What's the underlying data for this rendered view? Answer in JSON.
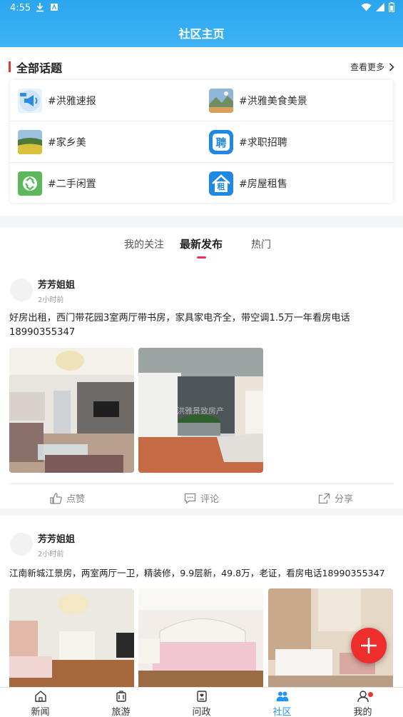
{
  "status_bar": {
    "time": "4:55"
  },
  "header": {
    "title": "社区主页"
  },
  "topics": {
    "title": "全部话题",
    "more": "查看更多",
    "items": [
      {
        "label": "#洪雅速报",
        "icon": "megaphone-icon",
        "color": "#2b8de0"
      },
      {
        "label": "#洪雅美食美景",
        "icon": "landscape-photo-icon",
        "color": "#3b7dbb"
      },
      {
        "label": "#家乡美",
        "icon": "field-photo-icon",
        "color": "#5a8a3c"
      },
      {
        "label": "#求职招聘",
        "icon": "recruit-icon",
        "color": "#1e88e5",
        "glyph": "聘"
      },
      {
        "label": "#二手闲置",
        "icon": "recycle-icon",
        "color": "#5cb85c"
      },
      {
        "label": "#房屋租售",
        "icon": "house-rent-icon",
        "color": "#1e88e5",
        "glyph": "租"
      }
    ]
  },
  "tabs": [
    {
      "label": "我的关注",
      "active": false
    },
    {
      "label": "最新发布",
      "active": true
    },
    {
      "label": "热门",
      "active": false
    }
  ],
  "posts": [
    {
      "user": "芳芳姐姐",
      "time": "2小时前",
      "text": "好房出租，西门带花园3室两厅带书房，家具家电齐全，带空调1.5万一年看房电话18990355347",
      "photos": [
        "living-room-photo",
        "courtyard-photo"
      ],
      "watermark": "洪雅景致房产",
      "actions": {
        "like": "点赞",
        "comment": "评论",
        "share": "分享"
      }
    },
    {
      "user": "芳芳姐姐",
      "time": "2小时前",
      "text": "江南新城江景房，两室两厅一卫，精装修，9.9层新，49.8万，老证，看房电话18990355347",
      "photos": [
        "living-room-photo",
        "bedroom-photo",
        "bathroom-photo"
      ]
    }
  ],
  "bottom_nav": [
    {
      "label": "新闻",
      "icon": "home-icon",
      "active": false
    },
    {
      "label": "旅游",
      "icon": "suitcase-icon",
      "active": false
    },
    {
      "label": "问政",
      "icon": "ask-icon",
      "active": false
    },
    {
      "label": "社区",
      "icon": "community-icon",
      "active": true
    },
    {
      "label": "我的",
      "icon": "user-icon",
      "active": false,
      "badge": true
    }
  ],
  "colors": {
    "primary": "#2aa6f0",
    "accent_red": "#ee2d2d",
    "tab_indicator": "#e8335e",
    "nav_active": "#2196f3"
  }
}
